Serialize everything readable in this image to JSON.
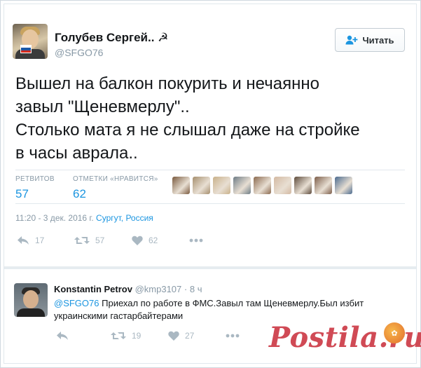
{
  "tweet": {
    "author_name": "Голубев Сергей.. ☭",
    "author_handle": "@SFGO76",
    "follow_label": "Читать",
    "text_lines": [
      "Вышел на балкон покурить и нечаянно",
      "завыл \"Щеневмерлу\"..",
      "Столько мата я не слышал даже на стройке",
      "в часы аврала.."
    ],
    "stats": {
      "retweets_label": "РЕТВИТОВ",
      "retweets_value": "57",
      "likes_label": "ОТМЕТКИ «НРАВИТСЯ»",
      "likes_value": "62"
    },
    "time": "11:20 - 3 дек. 2016 г.",
    "location": "Сургут, Россия",
    "actions": {
      "replies": "17",
      "retweets": "57",
      "likes": "62"
    },
    "liker_colors": [
      "#7a5a3e",
      "#a68f6e",
      "#c9b18a",
      "#6e7c86",
      "#8b6a4f",
      "#d3b9a2",
      "#5d4b3c",
      "#7d5e4a",
      "#4b6b8f"
    ]
  },
  "reply": {
    "author_name": "Konstantin Petrov",
    "author_handle": "@kmp3107",
    "time": "· 8 ч",
    "mention": "@SFGO76",
    "text_line1": "Приехал по работе в ФМС.Завыл там Щеневмерлу.Был избит",
    "text_line2": "украинскими гастарбайтерами",
    "actions": {
      "retweets": "19",
      "likes": "27"
    }
  },
  "watermark": {
    "text": "Postila.ru"
  },
  "colors": {
    "link": "#1b95e0",
    "muted": "#8899a6",
    "icon": "#aab8c2",
    "watermark": "#d04a55"
  }
}
